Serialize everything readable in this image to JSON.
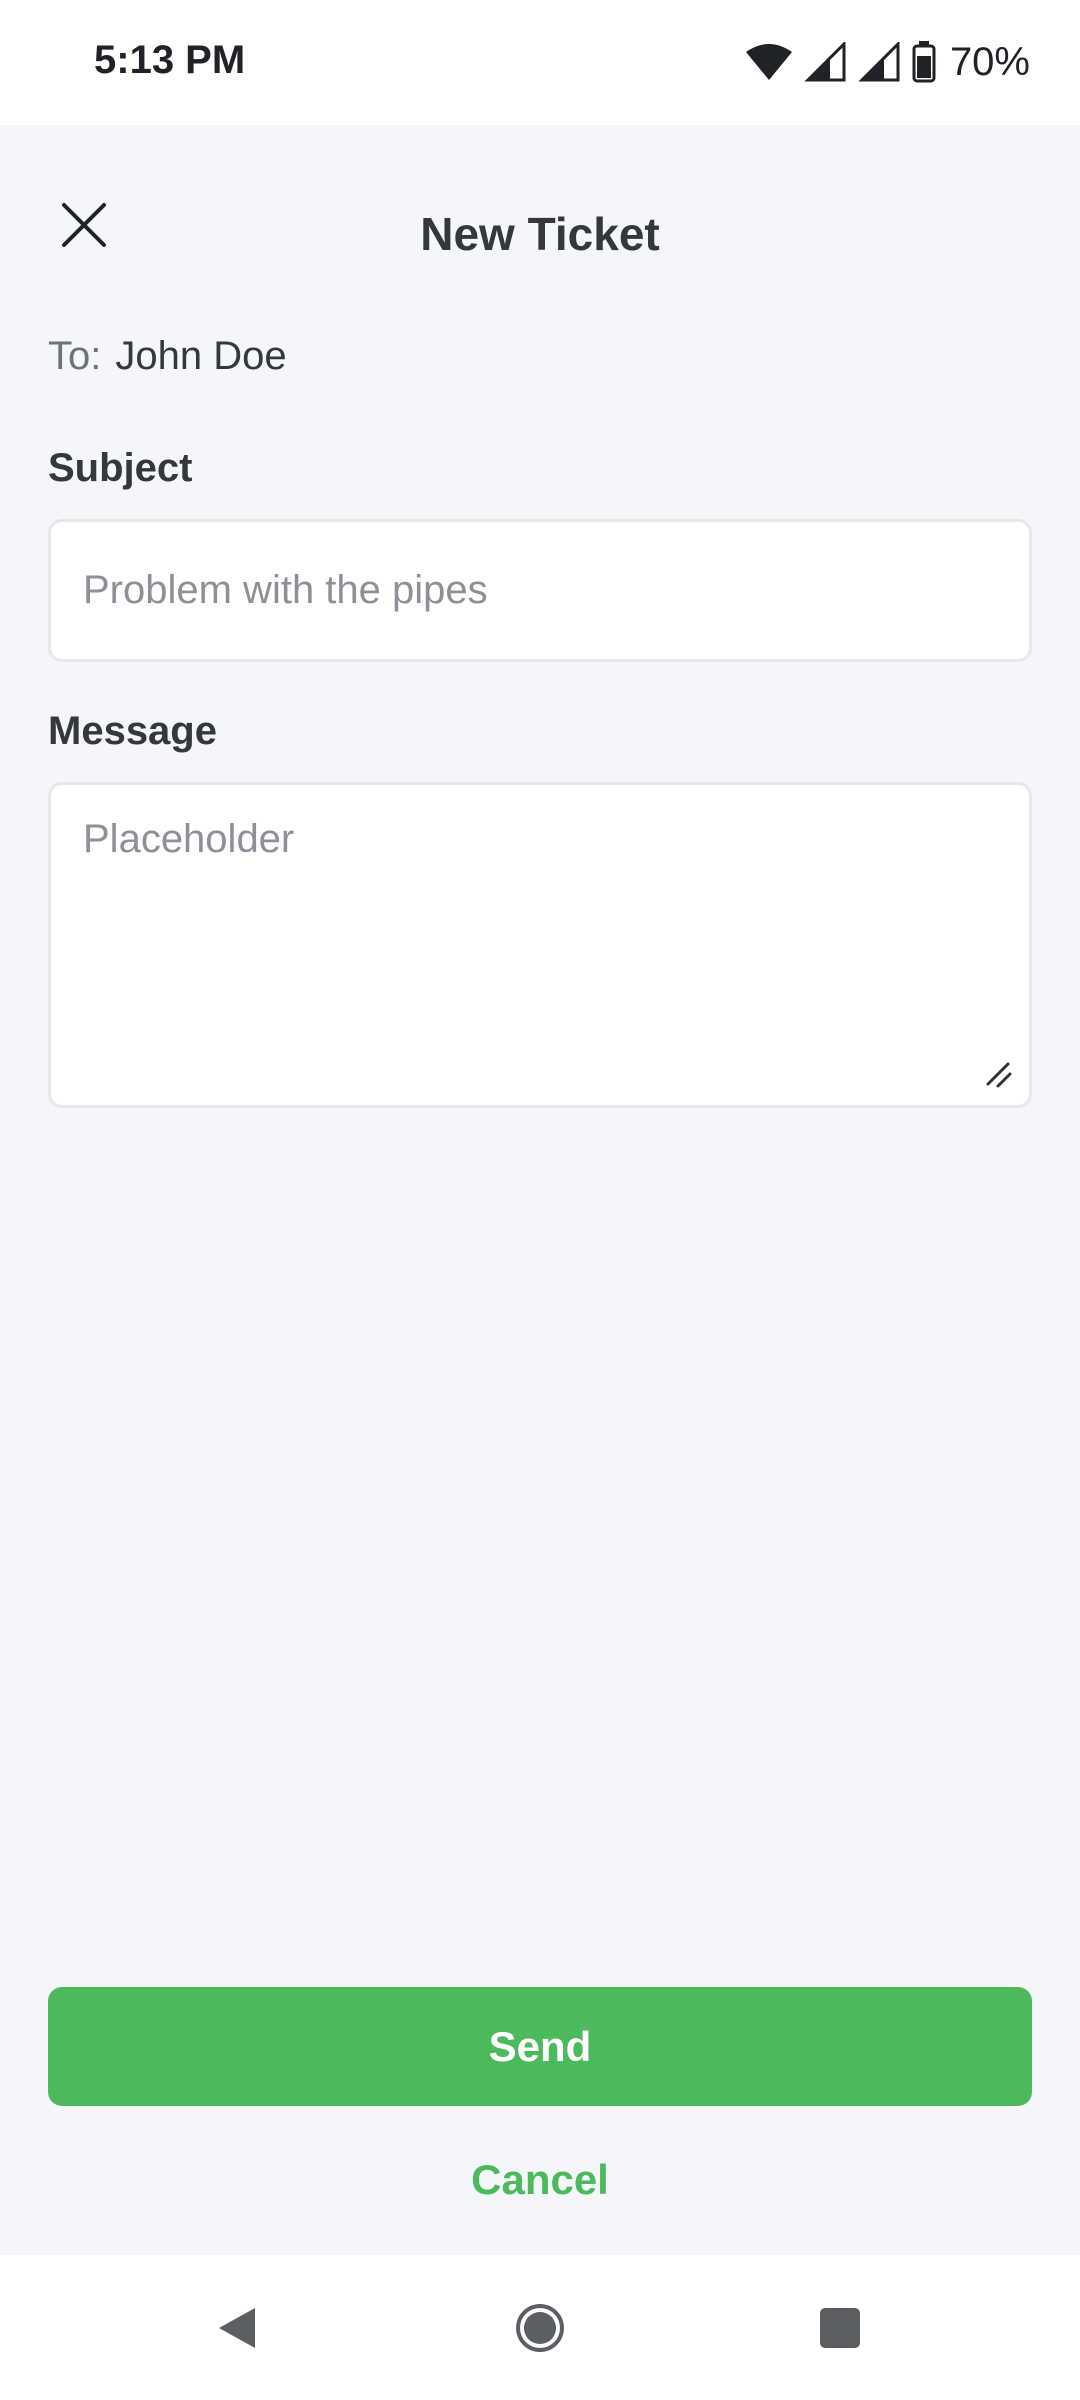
{
  "status_bar": {
    "time": "5:13 PM",
    "battery_percent": "70%",
    "icons": [
      "wifi-icon",
      "cell-signal-icon",
      "cell-signal-icon",
      "battery-icon"
    ]
  },
  "header": {
    "title": "New Ticket",
    "close_icon": "close-icon"
  },
  "form": {
    "to_label": "To:",
    "to_value": "John Doe",
    "subject_label": "Subject",
    "subject_placeholder": "Problem with the pipes",
    "message_label": "Message",
    "message_placeholder": "Placeholder"
  },
  "actions": {
    "send_label": "Send",
    "cancel_label": "Cancel"
  },
  "colors": {
    "accent": "#4cb95c",
    "background": "#f4f6fa",
    "text": "#34373c"
  },
  "nav_bar": {
    "icons": [
      "back-icon",
      "home-icon",
      "recents-icon"
    ]
  }
}
